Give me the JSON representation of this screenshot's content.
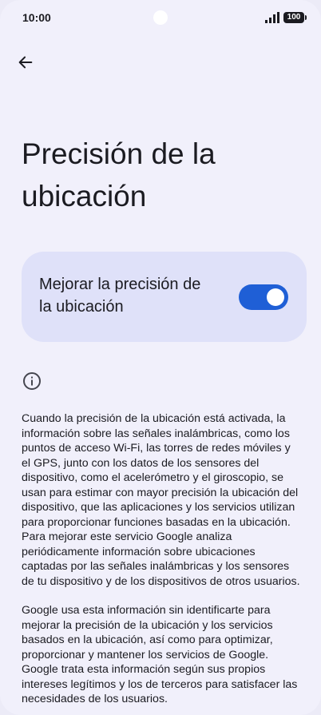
{
  "status_bar": {
    "time": "10:00",
    "battery": "100"
  },
  "page": {
    "title": "Precisión de la ubicación"
  },
  "toggle": {
    "label": "Mejorar la precisión de la ubicación",
    "enabled": true
  },
  "body": {
    "paragraph1": "Cuando la precisión de la ubicación está activada, la información sobre las señales inalámbricas, como los puntos de acceso Wi‑Fi, las torres de redes móviles y el GPS, junto con los datos de los sensores del dispositivo, como el acelerómetro y el giroscopio, se usan para estimar con mayor precisión la ubicación del dispositivo, que las aplicaciones y los servicios utilizan para proporcionar funciones basadas en la ubicación. Para mejorar este servicio Google analiza periódicamente información sobre ubicaciones captadas por las señales inalámbricas y los sensores de tu dispositivo y de los dispositivos de otros usuarios.",
    "paragraph2": "Google usa esta información sin identificarte para mejorar la precisión de la ubicación y los servicios basados en la ubicación, así como para optimizar, proporcionar y mantener los servicios de Google. Google trata esta información según sus propios intereses legítimos y los de terceros para satisfacer las necesidades de los usuarios."
  },
  "icons": {
    "back": "arrow-left-icon",
    "info": "info-circle-icon"
  },
  "colors": {
    "accent": "#1f5fd6",
    "card": "#dfe1f9",
    "background": "#f1f0fb"
  }
}
